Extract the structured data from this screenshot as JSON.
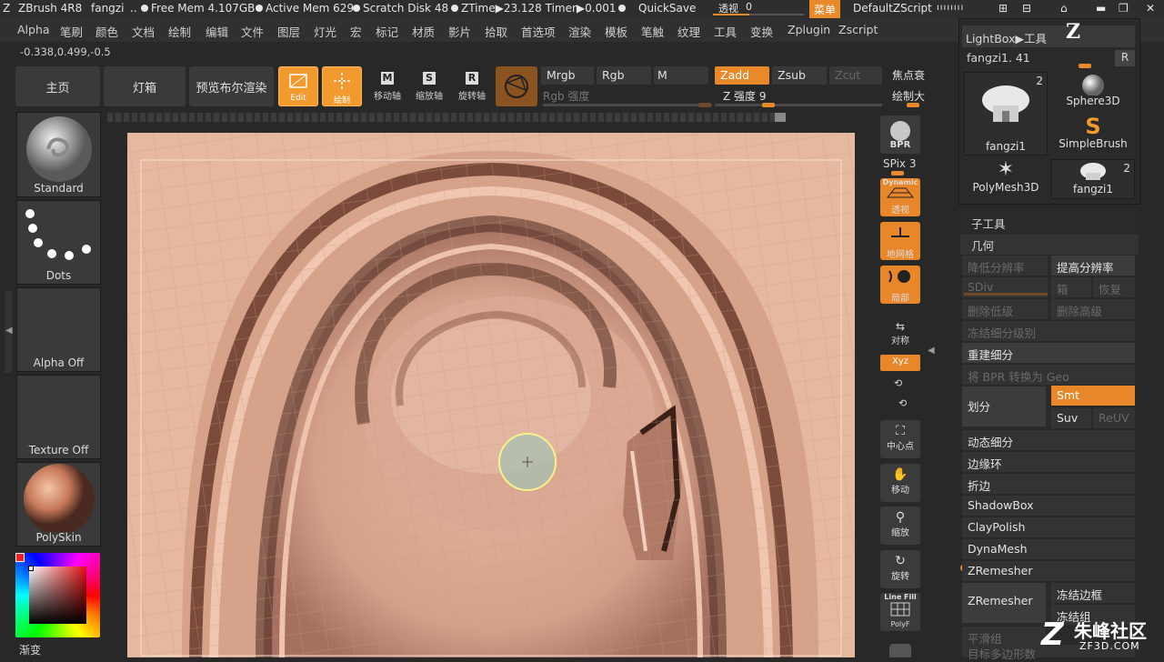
{
  "titlebar": {
    "app": "ZBrush 4R8",
    "doc": "fangzi",
    "dots": "..",
    "free_mem": "Free Mem 4.107GB",
    "active_mem": "Active Mem 629",
    "scratch": "Scratch Disk 48",
    "ztime": "ZTime▶23.128 Timer▶0.001",
    "quicksave": "QuickSave",
    "toushi": "透视",
    "toushi_val": "0",
    "menu": "菜单",
    "zscript": "DefaultZScript"
  },
  "menubar": [
    "Alpha",
    "笔刷",
    "颜色",
    "文档",
    "绘制",
    "编辑",
    "文件",
    "图层",
    "灯光",
    "宏",
    "标记",
    "材质",
    "影片",
    "拾取",
    "首选项",
    "渲染",
    "模板",
    "笔触",
    "纹理",
    "工具",
    "变换",
    "Zplugin",
    "Zscript"
  ],
  "coords": "-0.338,0.499,-0.5",
  "toolbar": {
    "home": "主页",
    "lightbox": "灯箱",
    "bpr": "预览布尔渲染",
    "edit": "Edit",
    "draw": "绘制",
    "move": "移动轴",
    "scale": "缩放轴",
    "rotate": "旋转轴",
    "mrgb": "Mrgb",
    "rgb": "Rgb",
    "m": "M",
    "rgb_strength": "Rgb 强度",
    "zadd": "Zadd",
    "zsub": "Zsub",
    "zcut": "Zcut",
    "z_strength": "Z 强度 9",
    "focal": "焦点衰",
    "draw_size": "绘制大"
  },
  "left": {
    "brush": "Standard",
    "stroke": "Dots",
    "alpha": "Alpha Off",
    "texture": "Texture Off",
    "material": "PolySkin",
    "gradient": "渐变"
  },
  "right_shelf": {
    "bpr": "BPR",
    "spix": "SPix 3",
    "dynamic": "Dynamic",
    "persp": "透视",
    "floor": "地网格",
    "local": "局部",
    "sym": "对称",
    "xyz": "Xyz",
    "center": "中心点",
    "move": "移动",
    "zoom": "缩放",
    "rotate": "旋转",
    "linefill": "Line Fill",
    "polyf": "PolyF"
  },
  "tool_palette": {
    "lightbox_tool": "LightBox▶工具",
    "tool_name": "fangzi1. 41",
    "r": "R",
    "tools": [
      {
        "name": "fangzi1",
        "count": "2"
      },
      {
        "name": "Sphere3D",
        "count": ""
      },
      {
        "name": "SimpleBrush",
        "count": ""
      },
      {
        "name": "PolyMesh3D",
        "count": ""
      },
      {
        "name": "fangzi1",
        "count": "2"
      }
    ],
    "subtool": "子工具",
    "geometry": "几何",
    "lower_res": "降低分辨率",
    "higher_res": "提高分辨率",
    "sdiv": "SDiv",
    "cage": "箱",
    "restore": "恢复",
    "del_lower": "删除低级",
    "del_higher": "删除高级",
    "freeze_sub": "冻结细分级别",
    "reconstruct": "重建细分",
    "bpr_geo": "将 BPR 转换为 Geo",
    "divide": "划分",
    "smt": "Smt",
    "suv": "Suv",
    "reuv": "ReUV",
    "dynamic_sub": "动态细分",
    "edge_loop": "边缘环",
    "crease": "折边",
    "shadowbox": "ShadowBox",
    "claypolish": "ClayPolish",
    "dynamesh": "DynaMesh",
    "zremesher": "ZRemesher",
    "zremesher_btn": "ZRemesher",
    "freeze_border": "冻结边框",
    "freeze_groups": "冻结组",
    "smooth_groups": "平滑组",
    "target_poly": "目标多边形数"
  },
  "watermark": {
    "brand": "朱峰社区",
    "url": "ZF3D.COM"
  }
}
